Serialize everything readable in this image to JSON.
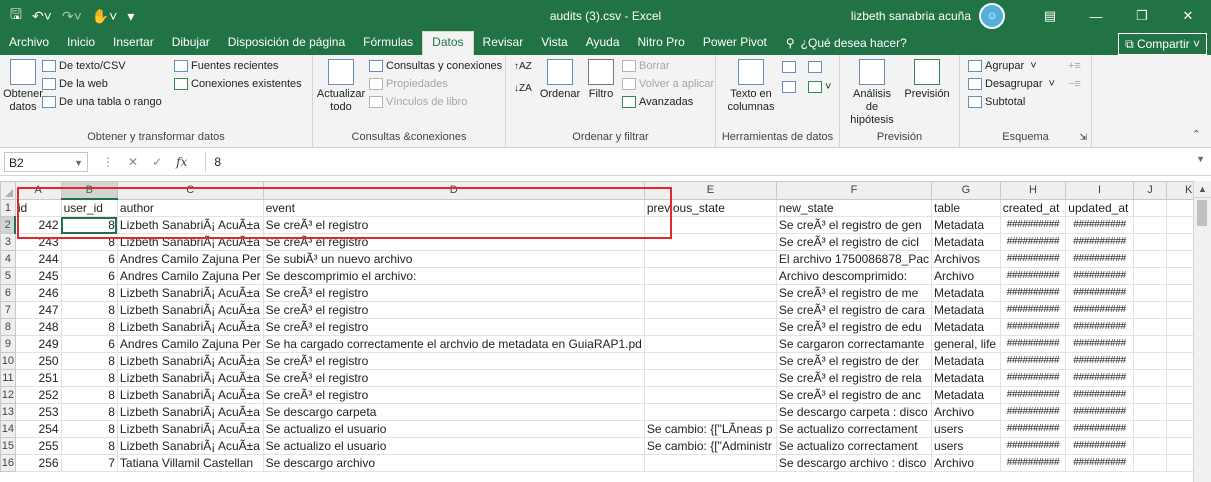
{
  "window": {
    "title": "audits (3).csv  -  Excel",
    "user_name": "lizbeth sanabria acuña",
    "controls": [
      "minimize",
      "restore",
      "close"
    ]
  },
  "quick_access": [
    "save-icon",
    "undo-icon",
    "redo-icon",
    "touch-mode-icon",
    "customize-icon"
  ],
  "menu": {
    "tabs": [
      "Archivo",
      "Inicio",
      "Insertar",
      "Dibujar",
      "Disposición de página",
      "Fórmulas",
      "Datos",
      "Revisar",
      "Vista",
      "Ayuda",
      "Nitro Pro",
      "Power Pivot"
    ],
    "active_tab": "Datos",
    "tell_me": "¿Qué desea hacer?",
    "share": "Compartir"
  },
  "ribbon": {
    "get_data": {
      "big_label": "Obtener datos",
      "items": [
        "De texto/CSV",
        "De la web",
        "De una tabla o rango",
        "Fuentes recientes",
        "Conexiones existentes"
      ],
      "label": "Obtener y transformar datos"
    },
    "queries": {
      "big_label": "Actualizar todo",
      "items": [
        "Consultas y conexiones",
        "Propiedades",
        "Vínculos de libro"
      ],
      "label": "Consultas &conexiones"
    },
    "sort_filter": {
      "sort_label": "Ordenar",
      "filter_label": "Filtro",
      "items": [
        "Borrar",
        "Volver a aplicar",
        "Avanzadas"
      ],
      "label": "Ordenar y filtrar"
    },
    "data_tools": {
      "big_label": "Texto en columnas",
      "label": "Herramientas de datos"
    },
    "forecast": {
      "whatif_label": "Análisis de hipótesis",
      "forecast_label": "Previsión",
      "label": "Previsión"
    },
    "outline": {
      "items": [
        "Agrupar",
        "Desagrupar",
        "Subtotal"
      ],
      "label": "Esquema"
    }
  },
  "formula_bar": {
    "name_box": "B2",
    "value": "8"
  },
  "sheet": {
    "columns": [
      "A",
      "B",
      "C",
      "D",
      "E",
      "F",
      "G",
      "H",
      "I",
      "J",
      "K"
    ],
    "selected_column": "B",
    "selected_row": "2",
    "rows": [
      {
        "n": "1",
        "cells": [
          "id",
          "user_id",
          "author",
          "event",
          "previous_state",
          "new_state",
          "table",
          "created_at",
          "updated_at",
          "",
          ""
        ]
      },
      {
        "n": "2",
        "cells": [
          "242",
          "8",
          "Lizbeth SanabriÃ¡ AcuÃ±a",
          "Se creÃ³ el registro",
          "",
          "Se creÃ³ el registro de gen",
          "Metadata",
          "##########",
          "##########",
          "",
          ""
        ]
      },
      {
        "n": "3",
        "cells": [
          "243",
          "8",
          "Lizbeth SanabriÃ¡ AcuÃ±a",
          "Se creÃ³ el registro",
          "",
          "Se creÃ³ el registro de cicl",
          "Metadata",
          "##########",
          "##########",
          "",
          ""
        ]
      },
      {
        "n": "4",
        "cells": [
          "244",
          "6",
          "Andres Camilo Zajuna Per",
          "Se subiÃ³ un nuevo archivo",
          "",
          "El archivo 1750086878_Pac",
          "Archivos",
          "##########",
          "##########",
          "",
          ""
        ]
      },
      {
        "n": "5",
        "cells": [
          "245",
          "6",
          "Andres Camilo Zajuna Per",
          "Se descomprimio el archivo:",
          "",
          "Archivo descomprimido:",
          "Archivo",
          "##########",
          "##########",
          "",
          ""
        ]
      },
      {
        "n": "6",
        "cells": [
          "246",
          "8",
          "Lizbeth SanabriÃ¡ AcuÃ±a",
          "Se creÃ³ el registro",
          "",
          "Se creÃ³ el registro de me",
          "Metadata",
          "##########",
          "##########",
          "",
          ""
        ]
      },
      {
        "n": "7",
        "cells": [
          "247",
          "8",
          "Lizbeth SanabriÃ¡ AcuÃ±a",
          "Se creÃ³ el registro",
          "",
          "Se creÃ³ el registro de cara",
          "Metadata",
          "##########",
          "##########",
          "",
          ""
        ]
      },
      {
        "n": "8",
        "cells": [
          "248",
          "8",
          "Lizbeth SanabriÃ¡ AcuÃ±a",
          "Se creÃ³ el registro",
          "",
          "Se creÃ³ el registro de edu",
          "Metadata",
          "##########",
          "##########",
          "",
          ""
        ]
      },
      {
        "n": "9",
        "cells": [
          "249",
          "6",
          "Andres Camilo Zajuna Per",
          "Se ha cargado correctamente el archvio de metadata en GuiaRAP1.pd",
          "",
          "Se cargaron correctamante",
          "general, life",
          "##########",
          "##########",
          "",
          ""
        ]
      },
      {
        "n": "10",
        "cells": [
          "250",
          "8",
          "Lizbeth SanabriÃ¡ AcuÃ±a",
          "Se creÃ³ el registro",
          "",
          "Se creÃ³ el registro de der",
          "Metadata",
          "##########",
          "##########",
          "",
          ""
        ]
      },
      {
        "n": "11",
        "cells": [
          "251",
          "8",
          "Lizbeth SanabriÃ¡ AcuÃ±a",
          "Se creÃ³ el registro",
          "",
          "Se creÃ³ el registro de rela",
          "Metadata",
          "##########",
          "##########",
          "",
          ""
        ]
      },
      {
        "n": "12",
        "cells": [
          "252",
          "8",
          "Lizbeth SanabriÃ¡ AcuÃ±a",
          "Se creÃ³ el registro",
          "",
          "Se creÃ³ el registro de anc",
          "Metadata",
          "##########",
          "##########",
          "",
          ""
        ]
      },
      {
        "n": "13",
        "cells": [
          "253",
          "8",
          "Lizbeth SanabriÃ¡ AcuÃ±a",
          "Se descargo carpeta",
          "",
          "Se descargo carpeta : disco",
          "Archivo",
          "##########",
          "##########",
          "",
          ""
        ]
      },
      {
        "n": "14",
        "cells": [
          "254",
          "8",
          "Lizbeth SanabriÃ¡ AcuÃ±a",
          "Se actualizo el usuario",
          "Se cambio: {[\"LÃ­neas p",
          "Se actualizo correctament",
          "users",
          "##########",
          "##########",
          "",
          ""
        ]
      },
      {
        "n": "15",
        "cells": [
          "255",
          "8",
          "Lizbeth SanabriÃ¡ AcuÃ±a",
          "Se actualizo el usuario",
          "Se cambio: {[\"Administr",
          "Se actualizo correctament",
          "users",
          "##########",
          "##########",
          "",
          ""
        ]
      },
      {
        "n": "16",
        "cells": [
          "256",
          "7",
          "Tatiana Villamil Castellan",
          "Se descargo archivo",
          "",
          "Se descargo archivo : disco",
          "Archivo",
          "##########",
          "##########",
          "",
          ""
        ]
      }
    ]
  },
  "colors": {
    "excel_green": "#217346",
    "highlight_box": "#e0282e"
  }
}
